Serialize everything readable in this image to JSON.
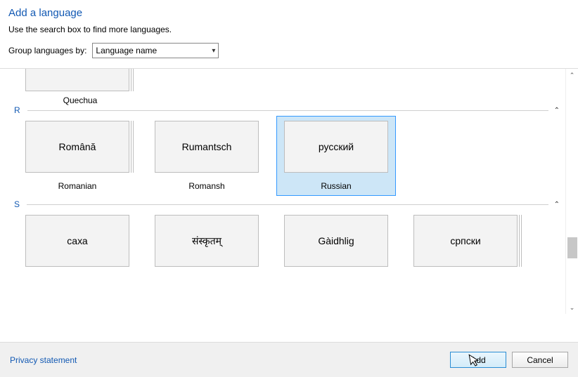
{
  "header": {
    "title": "Add a language",
    "subtitle": "Use the search box to find more languages.",
    "group_label": "Group languages by:",
    "group_value": "Language name"
  },
  "partial": {
    "caption": "Quechua"
  },
  "sections": [
    {
      "letter": "R",
      "items": [
        {
          "native": "Română",
          "english": "Romanian",
          "stacked": true,
          "selected": false
        },
        {
          "native": "Rumantsch",
          "english": "Romansh",
          "stacked": false,
          "selected": false
        },
        {
          "native": "русский",
          "english": "Russian",
          "stacked": false,
          "selected": true
        }
      ]
    },
    {
      "letter": "S",
      "items": [
        {
          "native": "саха",
          "english": "",
          "stacked": false,
          "selected": false
        },
        {
          "native": "संस्कृतम्",
          "english": "",
          "stacked": false,
          "selected": false
        },
        {
          "native": "Gàidhlig",
          "english": "",
          "stacked": false,
          "selected": false
        },
        {
          "native": "српски",
          "english": "",
          "stacked": true,
          "selected": false
        }
      ]
    }
  ],
  "footer": {
    "privacy": "Privacy statement",
    "add": "Add",
    "cancel": "Cancel"
  }
}
